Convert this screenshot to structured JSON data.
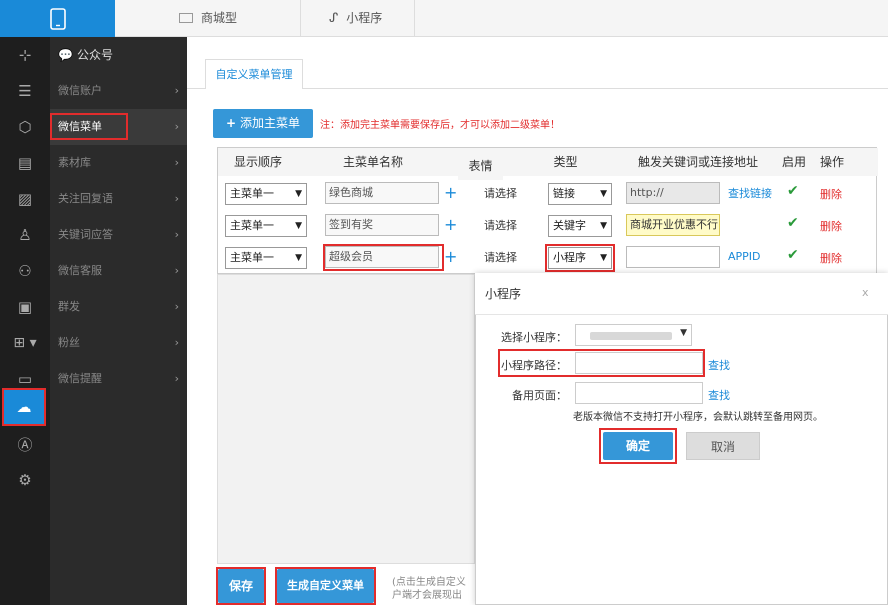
{
  "topbar": {
    "tab_shop": "商城型",
    "tab_mini": "小程序"
  },
  "submenu": {
    "header": "公众号",
    "items": [
      "微信账户",
      "微信菜单",
      "素材库",
      "关注回复语",
      "关键词应答",
      "微信客服",
      "群发",
      "粉丝",
      "微信提醒"
    ]
  },
  "main": {
    "tab_title": "自定义菜单管理",
    "add_button": "添加主菜单",
    "notice": "注：添加完主菜单需要保存后，才可以添加二级菜单！",
    "headers": [
      "显示顺序",
      "主菜单名称",
      "表情",
      "类型",
      "触发关键词或连接地址",
      "启用",
      "操作"
    ],
    "rows": [
      {
        "order": "主菜单一",
        "name": "绿色商城",
        "emoji": "请选择",
        "type": "链接",
        "target": "http://",
        "action_link": "查找链接",
        "enabled": "✔",
        "delete": "删除"
      },
      {
        "order": "主菜单一",
        "name": "签到有奖",
        "emoji": "请选择",
        "type": "关键字",
        "target": "商城开业优惠不行",
        "action_link": "",
        "enabled": "✔",
        "delete": "删除"
      },
      {
        "order": "主菜单一",
        "name": "超级会员",
        "emoji": "请选择",
        "type": "小程序",
        "target": "",
        "action_link": "APPID",
        "enabled": "✔",
        "delete": "删除"
      }
    ],
    "save_button": "保存",
    "generate_button": "生成自定义菜单",
    "footer_note_1": "(点击生成自定义",
    "footer_note_2": "户端才会展现出"
  },
  "dialog": {
    "title": "小程序",
    "close": "x",
    "select_label": "选择小程序：",
    "select_value": "",
    "path_label": "小程序路径：",
    "path_find": "查找",
    "backup_label": "备用页面：",
    "backup_find": "查找",
    "hint": "老版本微信不支持打开小程序，会默认跳转至备用网页。",
    "ok": "确定",
    "cancel": "取消"
  }
}
